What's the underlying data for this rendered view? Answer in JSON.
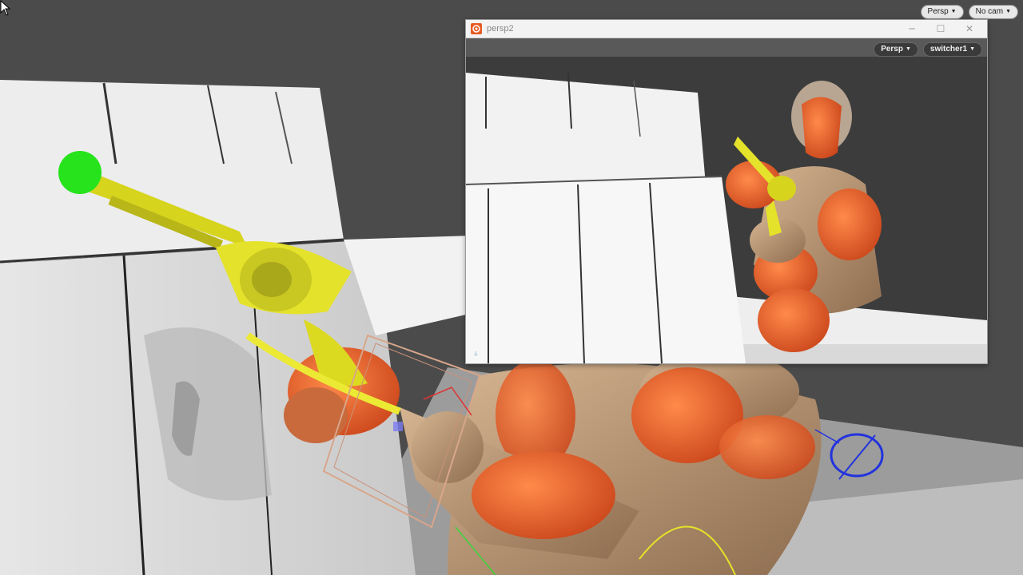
{
  "main_viewport": {
    "camera_menu": "Persp",
    "cam_menu": "No cam"
  },
  "float_window": {
    "title": "persp2",
    "camera_menu": "Persp",
    "switcher_menu": "switcher1",
    "controls": {
      "minimize": "─",
      "maximize": "☐",
      "close": "✕"
    }
  },
  "colors": {
    "accent_gun": "#e4e22a",
    "handle_green": "#27e31c",
    "robot_orange": "#e8622a",
    "gizmo_blue": "#2233dd"
  }
}
